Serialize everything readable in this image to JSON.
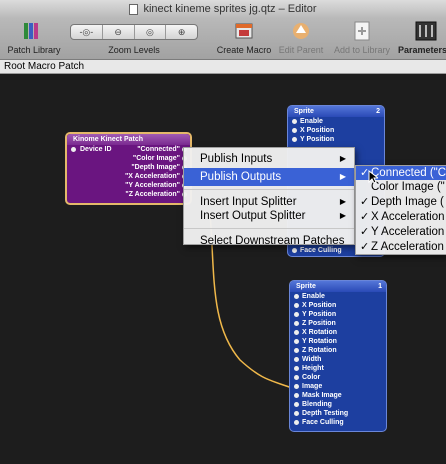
{
  "window": {
    "title": "kinect kineme sprites jg.qtz – Editor"
  },
  "toolbar": {
    "patch_library": "Patch Library",
    "zoom_levels": "Zoom Levels",
    "create_macro": "Create Macro",
    "edit_parent": "Edit Parent",
    "add_to_library": "Add to Library",
    "parameters": "Parameters"
  },
  "pathbar": {
    "label": "Root Macro Patch"
  },
  "kinect_patch": {
    "title": "Kinome Kinect Patch",
    "input": "Device ID",
    "outputs": [
      "\"Connected\"",
      "\"Color Image\"",
      "\"Depth Image\"",
      "\"X Acceleration\"",
      "\"Y Acceleration\"",
      "\"Z Acceleration\""
    ]
  },
  "sprite_top": {
    "title": "Sprite",
    "badge": "2",
    "ports": [
      "Enable",
      "X Position",
      "Y Position"
    ],
    "bottom_port": "Face Culling"
  },
  "sprite_bottom": {
    "title": "Sprite",
    "badge": "1",
    "ports": [
      "Enable",
      "X Position",
      "Y Position",
      "Z Position",
      "X Rotation",
      "Y Rotation",
      "Z Rotation",
      "Width",
      "Height",
      "Color",
      "Image",
      "Mask Image",
      "Blending",
      "Depth Testing",
      "Face Culling"
    ]
  },
  "context_menu": {
    "publish_inputs": "Publish Inputs",
    "publish_outputs": "Publish Outputs",
    "insert_input_splitter": "Insert Input Splitter",
    "insert_output_splitter": "Insert Output Splitter",
    "select_downstream": "Select Downstream Patches"
  },
  "submenu": {
    "items": [
      "Connected (\"C",
      "Color Image (\"",
      "Depth Image (",
      "X Acceleration",
      "Y Acceleration",
      "Z Acceleration"
    ],
    "checked": [
      true,
      false,
      true,
      true,
      true,
      true
    ]
  },
  "colors": {
    "sprite_blue": "#1d3fa0",
    "kinect_purple": "#6a1580",
    "connection_yellow": "#f0b84a",
    "menu_highlight": "#3a62d6"
  }
}
